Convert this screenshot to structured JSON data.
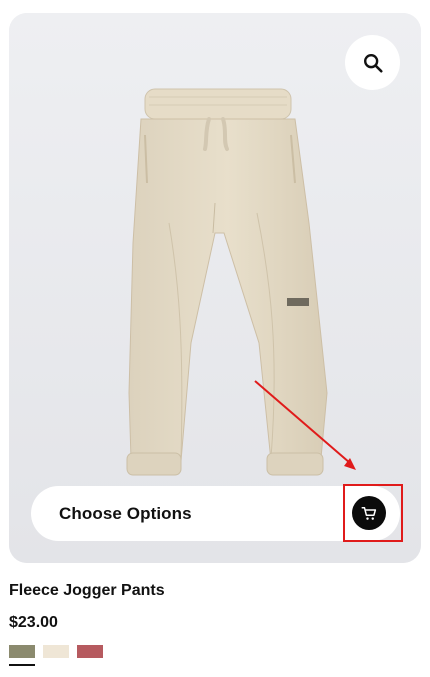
{
  "product": {
    "title": "Fleece Jogger Pants",
    "price": "$23.00",
    "image_alt": "Beige fleece jogger pants"
  },
  "actions": {
    "choose_options_label": "Choose Options",
    "zoom_icon": "search-icon",
    "cart_icon": "cart-icon"
  },
  "swatches": [
    {
      "color": "#8b8a6e",
      "selected": true
    },
    {
      "color": "#efe6d6",
      "selected": false
    },
    {
      "color": "#b65a5f",
      "selected": false
    }
  ],
  "annotation": {
    "color": "#e01b1b"
  }
}
